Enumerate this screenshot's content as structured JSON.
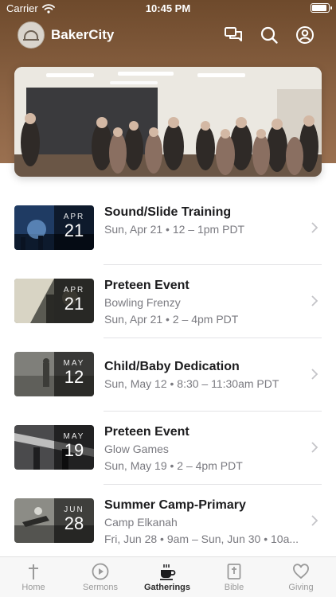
{
  "status_bar": {
    "carrier": "Carrier",
    "time": "10:45 PM",
    "battery_level": 0.95
  },
  "app": {
    "title": "BakerCity"
  },
  "events": [
    {
      "month": "APR",
      "day": "21",
      "title": "Sound/Slide Training",
      "subtitle": "",
      "when": "Sun, Apr 21 • 12 – 1pm PDT"
    },
    {
      "month": "APR",
      "day": "21",
      "title": "Preteen Event",
      "subtitle": "Bowling Frenzy",
      "when": "Sun, Apr 21 • 2 – 4pm PDT"
    },
    {
      "month": "MAY",
      "day": "12",
      "title": "Child/Baby Dedication",
      "subtitle": "",
      "when": "Sun, May 12 • 8:30 – 11:30am PDT"
    },
    {
      "month": "MAY",
      "day": "19",
      "title": "Preteen Event",
      "subtitle": "Glow Games",
      "when": "Sun, May 19 • 2 – 4pm PDT"
    },
    {
      "month": "JUN",
      "day": "28",
      "title": "Summer Camp-Primary",
      "subtitle": "Camp Elkanah",
      "when": "Fri, Jun 28 • 9am – Sun, Jun 30 • 10a..."
    }
  ],
  "tabs": [
    {
      "label": "Home",
      "icon": "cross-icon"
    },
    {
      "label": "Sermons",
      "icon": "play-circle-icon"
    },
    {
      "label": "Gatherings",
      "icon": "coffee-cup-icon",
      "active": true
    },
    {
      "label": "Bible",
      "icon": "bible-icon"
    },
    {
      "label": "Giving",
      "icon": "heart-icon"
    }
  ]
}
